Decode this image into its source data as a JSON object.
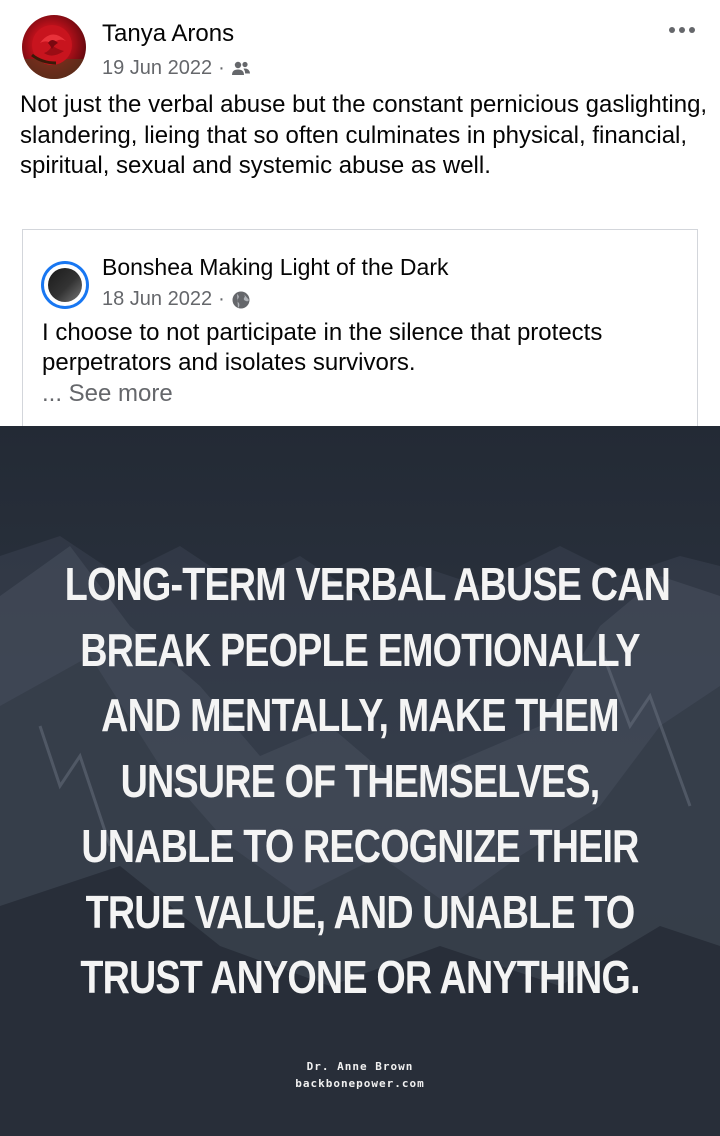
{
  "post": {
    "author": "Tanya Arons",
    "date": "19 Jun 2022",
    "separator": "·",
    "audience_icon": "friends-icon",
    "more_icon": "more-horizontal-icon",
    "text": "Not just the verbal abuse but the constant pernicious gaslighting, slandering, lieing that so often culminates in physical, financial, spiritual, sexual and systemic abuse as well."
  },
  "shared": {
    "author": "Bonshea Making Light of the Dark",
    "date": "18 Jun 2022",
    "separator": "·",
    "audience_icon": "globe-icon",
    "text": "I choose to not participate in the silence that protects perpetrators and isolates survivors.",
    "see_more": "... See more"
  },
  "image": {
    "quote_lines": [
      "LONG-TERM VERBAL ABUSE CAN",
      "BREAK PEOPLE EMOTIONALLY",
      "AND MENTALLY, MAKE THEM",
      "UNSURE OF THEMSELVES,",
      "UNABLE TO RECOGNIZE THEIR",
      "TRUE VALUE, AND UNABLE TO",
      "TRUST ANYONE OR ANYTHING."
    ],
    "credit_name": "Dr. Anne Brown",
    "credit_site": "backbonepower.com"
  },
  "colors": {
    "text": "#050505",
    "secondary_text": "#65676b",
    "avatar_ring": "#1877f2",
    "image_bg": "#2b3340"
  }
}
